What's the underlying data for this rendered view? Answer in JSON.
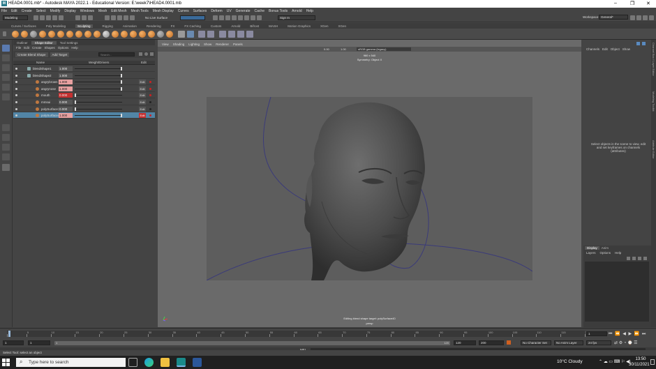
{
  "window": {
    "title": "HEAD4.0001.mb* - Autodesk MAYA 2022.1 - Educational Version: E:\\week7\\HEAD4.0001.mb",
    "logo_letter": "M",
    "minimize": "–",
    "maximize": "❐",
    "close": "✕"
  },
  "menubar": [
    "File",
    "Edit",
    "Create",
    "Select",
    "Modify",
    "Display",
    "Windows",
    "Mesh",
    "Edit Mesh",
    "Mesh Tools",
    "Mesh Display",
    "Curves",
    "Surfaces",
    "Deform",
    "UV",
    "Generate",
    "Cache",
    "Bonus Tools",
    "Arnold",
    "Help"
  ],
  "statusline": {
    "mode": "Modeling",
    "live_surface": "No Live Surface",
    "signin": "Sign In",
    "workspace_label": "Workspace:",
    "workspace_value": "General*"
  },
  "shelf_tabs": [
    "Curves / Surfaces",
    "Poly Modeling",
    "Sculpting",
    "Rigging",
    "Animation",
    "Rendering",
    "FX",
    "FX Caching",
    "Custom",
    "Arnold",
    "Bifrost",
    "MASH",
    "Motion Graphics",
    "XGen",
    "XGen"
  ],
  "active_shelf_tab": "Sculpting",
  "left_panel": {
    "tabs": [
      "Outliner",
      "Shape Editor",
      "Tool Settings"
    ],
    "active_tab": "Shape Editor",
    "menu": [
      "File",
      "Edit",
      "Create",
      "Shapes",
      "Options",
      "Help"
    ],
    "toolbar": {
      "create_blend_shape": "Create Blend Shape",
      "add_target": "Add Target",
      "search_placeholder": "Search..."
    },
    "columns": {
      "name": "Name",
      "weight": "Weight/Drivers",
      "edit": "Edit"
    },
    "rows": [
      {
        "name": "blendShape1",
        "value": "1.000",
        "level": 1,
        "edit": ""
      },
      {
        "name": "blendShape2",
        "value": "1.000",
        "level": 1,
        "edit": ""
      },
      {
        "name": "angrybrown",
        "value": "1.000",
        "level": 2,
        "edit": "Edit"
      },
      {
        "name": "angrynose",
        "value": "1.000",
        "level": 2,
        "edit": "Edit"
      },
      {
        "name": "mouth",
        "value": "0.000",
        "level": 2,
        "edit": "Edit"
      },
      {
        "name": "mmsui",
        "value": "0.000",
        "level": 2,
        "edit": "Edit"
      },
      {
        "name": "polySurface39",
        "value": "0.000",
        "level": 2,
        "edit": "Edit"
      },
      {
        "name": "polySurface40",
        "value": "1.000",
        "level": 2,
        "edit": "Edit"
      }
    ]
  },
  "viewport": {
    "menu": [
      "View",
      "Shading",
      "Lighting",
      "Show",
      "Renderer",
      "Panels"
    ],
    "toolbar_value1": "0.00",
    "toolbar_value2": "1.00",
    "colorspace": "sRGB gamma (legacy)",
    "overlay_line1": "960 x 540",
    "overlay_line2": "Symmetry: Object X",
    "bottom_line1": "Editing blend shape target: polySurface40",
    "bottom_line2": "persp"
  },
  "channel_box": {
    "menu": [
      "Channels",
      "Edit",
      "Object",
      "Show"
    ],
    "hint": "Select objects in the scene to view, edit and set keyframes on channels (attributes)"
  },
  "layer_editor": {
    "tabs": [
      "Display",
      "Anim"
    ],
    "active_tab": "Display",
    "menu": [
      "Layers",
      "Options",
      "Help"
    ]
  },
  "right_strip": [
    "Channel Box / Layer Editor",
    "Modeling Toolkit",
    "Attribute Editor"
  ],
  "timeline": {
    "ticks": [
      "1",
      "5",
      "10",
      "15",
      "20",
      "25",
      "30",
      "35",
      "40",
      "45",
      "50",
      "55",
      "60",
      "65",
      "70",
      "75",
      "80",
      "85",
      "90",
      "95",
      "100",
      "105",
      "110",
      "115",
      "120"
    ],
    "current_frame": "1"
  },
  "range": {
    "start": "1",
    "playback_start": "1",
    "inner_start": "1",
    "inner_end": "120",
    "playback_end": "120",
    "end": "200",
    "character_set": "No Character Set",
    "anim_layer": "No Anim Layer",
    "fps": "24 fps"
  },
  "mel": {
    "label": "MEL"
  },
  "help": {
    "text": "Select Tool: select an object"
  },
  "taskbar": {
    "search_placeholder": "Type here to search",
    "weather": "10°C  Cloudy",
    "time": "13:50",
    "date": "30/11/2021"
  }
}
